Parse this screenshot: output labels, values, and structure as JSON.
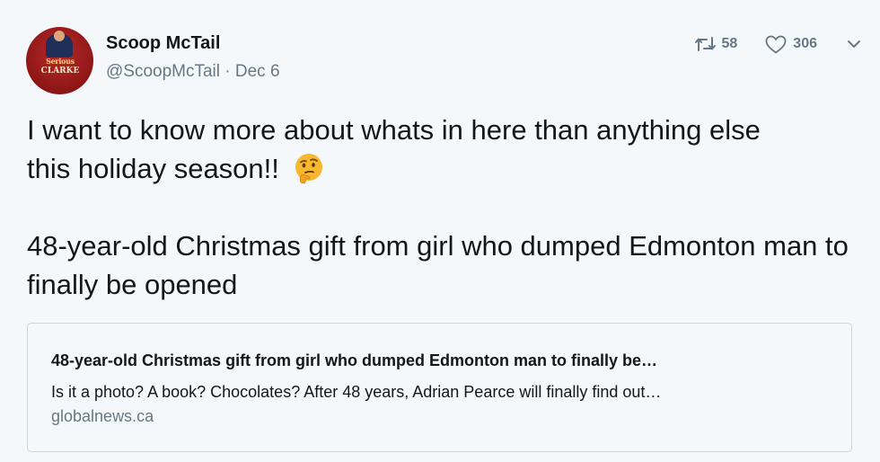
{
  "author": {
    "display_name": "Scoop McTail",
    "handle": "@ScoopMcTail",
    "separator": "·",
    "date": "Dec 6",
    "avatar": {
      "line1": "Serious",
      "line2": "CLARKE",
      "line3": ""
    }
  },
  "actions": {
    "retweet_icon": "retweet-icon",
    "retweet_count": "58",
    "like_icon": "heart-icon",
    "like_count": "306",
    "more_icon": "chevron-down-icon"
  },
  "tweet": {
    "line1": "I want to know more about whats in here than anything else",
    "line2": "this holiday season!!",
    "emoji": "thinking-face-emoji",
    "paragraph2": "48-year-old Christmas gift from girl who dumped Edmonton man to finally be opened"
  },
  "card": {
    "title": "48-year-old Christmas gift from girl who dumped Edmonton man to finally be…",
    "description": "Is it a photo? A book? Chocolates? After 48 years, Adrian Pearce will finally find out…",
    "domain": "globalnews.ca"
  },
  "colors": {
    "background": "#f5f8fa",
    "text": "#14171a",
    "secondary": "#657786",
    "border": "#ccd6dd",
    "avatar_red": "#8e1616"
  }
}
